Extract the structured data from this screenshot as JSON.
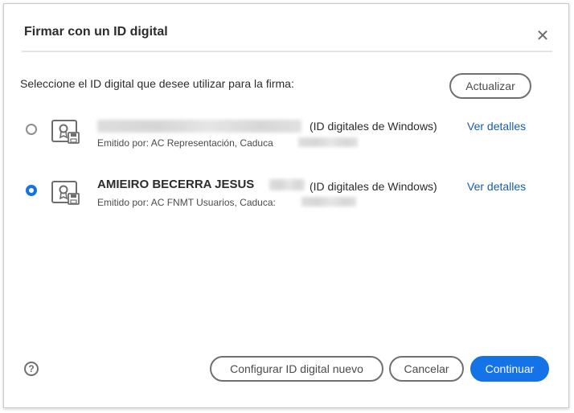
{
  "dialog": {
    "title": "Firmar con un ID digital",
    "close_icon": "close-icon"
  },
  "prompt": "Seleccione el ID digital que desee utilizar para la firma:",
  "refresh_label": "Actualizar",
  "ids": [
    {
      "selected": false,
      "name": "",
      "type": "(ID digitales de Windows)",
      "details_label": "Ver detalles",
      "issuer": "Emitido por: AC Representación, Caduca",
      "icon": "certificate-icon"
    },
    {
      "selected": true,
      "name": "AMIEIRO BECERRA JESUS",
      "type": "(ID digitales de Windows)",
      "details_label": "Ver detalles",
      "issuer": "Emitido por: AC FNMT Usuarios, Caduca:",
      "icon": "certificate-icon"
    }
  ],
  "footer": {
    "help_icon": "help-icon",
    "help_glyph": "?",
    "configure_label": "Configurar ID digital nuevo",
    "cancel_label": "Cancelar",
    "continue_label": "Continuar"
  },
  "colors": {
    "accent": "#1473e6",
    "link": "#1a5ea6"
  }
}
